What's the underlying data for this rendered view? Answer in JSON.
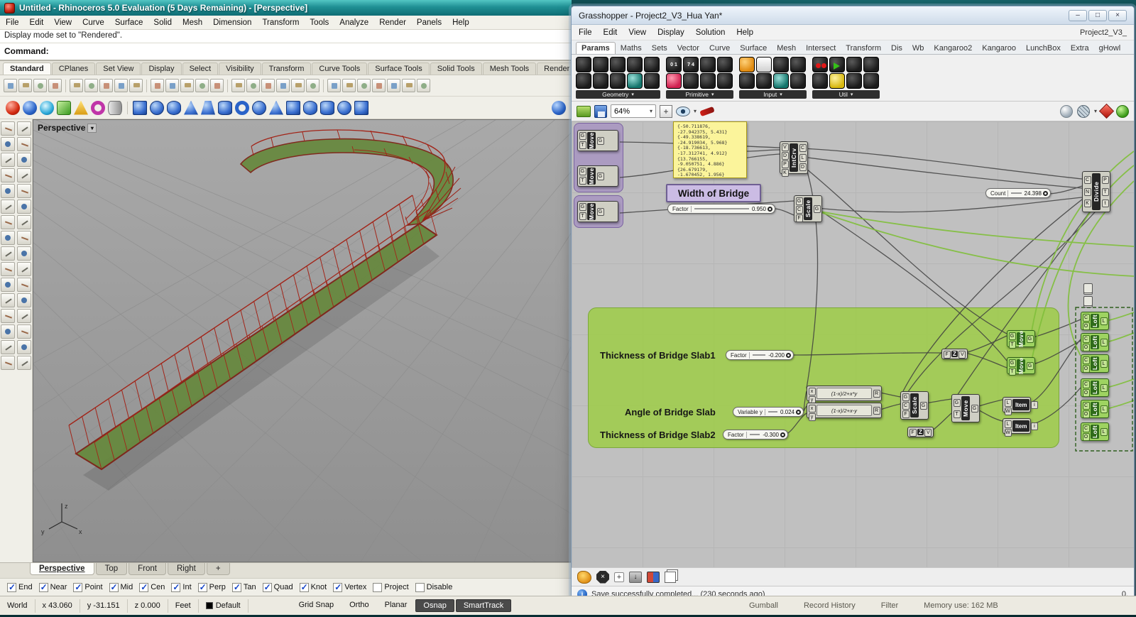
{
  "rhino": {
    "title": "Untitled - Rhinoceros 5.0 Evaluation (5 Days Remaining) - [Perspective]",
    "menu": [
      "File",
      "Edit",
      "View",
      "Curve",
      "Surface",
      "Solid",
      "Mesh",
      "Dimension",
      "Transform",
      "Tools",
      "Analyze",
      "Render",
      "Panels",
      "Help"
    ],
    "history_line": "Display mode set to \"Rendered\".",
    "command_label": "Command:",
    "toolbar_tabs": [
      "Standard",
      "CPlanes",
      "Set View",
      "Display",
      "Select",
      "Visibility",
      "Transform",
      "Curve Tools",
      "Surface Tools",
      "Solid Tools",
      "Mesh Tools",
      "Render T"
    ],
    "toolbar1_icons": [
      "new-file-icon",
      "open-file-icon",
      "save-icon",
      "print-icon",
      "cut-icon",
      "copy-icon",
      "paste-icon",
      "undo-icon",
      "redo-icon",
      "pan-icon",
      "zoom-extents-icon",
      "zoom-window-icon",
      "zoom-selected-icon",
      "rotate-view-icon",
      "grid-icon",
      "move-icon",
      "rotate-icon",
      "scale-icon",
      "hide-icon",
      "lock-icon",
      "layers-icon",
      "properties-icon",
      "render-icon",
      "shade-icon",
      "curve-tools-icon",
      "analyze-icon",
      "help-icon"
    ],
    "viewport": {
      "label": "Perspective",
      "tabs": [
        "Perspective",
        "Top",
        "Front",
        "Right"
      ],
      "new_tab": "+",
      "axis": {
        "x": "x",
        "y": "y",
        "z": "z"
      }
    },
    "osnap": {
      "items": [
        {
          "label": "End",
          "checked": true
        },
        {
          "label": "Near",
          "checked": true
        },
        {
          "label": "Point",
          "checked": true
        },
        {
          "label": "Mid",
          "checked": true
        },
        {
          "label": "Cen",
          "checked": true
        },
        {
          "label": "Int",
          "checked": true
        },
        {
          "label": "Perp",
          "checked": true
        },
        {
          "label": "Tan",
          "checked": true
        },
        {
          "label": "Quad",
          "checked": true
        },
        {
          "label": "Knot",
          "checked": true
        },
        {
          "label": "Vertex",
          "checked": true
        },
        {
          "label": "Project",
          "checked": false
        },
        {
          "label": "Disable",
          "checked": false
        }
      ]
    },
    "statusbar": {
      "cplane": "World",
      "x": "x 43.060",
      "y": "y -31.151",
      "z": "z 0.000",
      "units": "Feet",
      "layer": "Default",
      "panes": [
        "Grid Snap",
        "Ortho",
        "Planar",
        "Osnap",
        "SmartTrack"
      ],
      "right_panes": [
        "Gumball",
        "Record History",
        "Filter",
        "Memory use: 162 MB"
      ]
    }
  },
  "gh": {
    "title": "Grasshopper - Project2_V3_Hua Yan*",
    "window_buttons": {
      "minimize": "–",
      "maximize": "□",
      "close": "×"
    },
    "menu": [
      "File",
      "Edit",
      "View",
      "Display",
      "Solution",
      "Help"
    ],
    "doc_name": "Project2_V3_",
    "tabs": [
      "Params",
      "Maths",
      "Sets",
      "Vector",
      "Curve",
      "Surface",
      "Mesh",
      "Intersect",
      "Transform",
      "Dis",
      "Wb",
      "Kangaroo2",
      "Kangaroo",
      "LunchBox",
      "Extra",
      "gHowl"
    ],
    "palette": {
      "groups": [
        {
          "name": "Geometry",
          "icons": [
            "point-icon",
            "vector-icon",
            "plane-icon",
            "circle-icon",
            "curve-icon",
            "surface-icon",
            "brep-icon",
            "mesh-icon",
            "box-icon",
            "group-icon"
          ]
        },
        {
          "name": "Primitive",
          "icons": [
            "boolean-icon",
            "integer-icon",
            "number-icon",
            "text-icon",
            "colour-icon",
            "domain-icon",
            "path-icon",
            "matrix-icon"
          ]
        },
        {
          "name": "Input",
          "icons": [
            "number-slider-icon",
            "panel-icon",
            "value-list-icon",
            "button-icon",
            "toggle-icon",
            "graph-mapper-icon",
            "gradient-icon",
            "import-icon"
          ]
        },
        {
          "name": "Util",
          "icons": [
            "cherry-picker-icon",
            "jump-icon",
            "data-dam-icon",
            "relay-icon",
            "cluster-icon",
            "scribble-icon",
            "data-recorder-icon",
            "trigger-icon"
          ]
        }
      ],
      "boolean_glyph": "0 1",
      "integer_glyph": "7 4"
    },
    "toolbar": {
      "zoom": "64%"
    },
    "canvas": {
      "panels": {
        "width_of_bridge": "Width of Bridge",
        "thickness1": "Thickness of Bridge Slab1",
        "angle": "Angle of Bridge Slab",
        "thickness2": "Thickness of Bridge Slab2"
      },
      "yellow_panel_lines": [
        "{-50.711876,",
        "-27.942375, 5.431}",
        "{-49.338619,",
        "-24.919034, 5.968}",
        "{-18.736613,",
        "-17.312741, 4.912}",
        "{13.766155,",
        "-9.050751, 4.886}",
        "{26.679179,",
        "-1.670452, 1.956}"
      ],
      "sliders": {
        "width_factor": {
          "name": "Factor",
          "value": "0.950"
        },
        "count": {
          "name": "Count",
          "value": "24.398"
        },
        "thickness1_factor": {
          "name": "Factor",
          "value": "-0.200"
        },
        "angle_variable": {
          "name": "Variable y",
          "value": "0.024"
        },
        "thickness2_factor": {
          "name": "Factor",
          "value": "-0.300"
        }
      },
      "components": {
        "move": {
          "label": "Move",
          "in": [
            "G",
            "T"
          ],
          "out": [
            "G"
          ]
        },
        "intcrv": {
          "label": "IntCrv",
          "in": [
            "V",
            "D",
            "P",
            "K"
          ],
          "out": [
            "C",
            "L",
            "D"
          ]
        },
        "scale": {
          "label": "Scale",
          "in": [
            "G",
            "C",
            "F"
          ],
          "out": [
            "G"
          ]
        },
        "divide": {
          "label": "Divide",
          "in": [
            "C",
            "N",
            "K"
          ],
          "out": [
            "P",
            "T",
            "t"
          ]
        },
        "expr1": {
          "label": "(1-x)/2+x*y",
          "in": [
            "x",
            "y"
          ],
          "out": [
            "R"
          ]
        },
        "expr2": {
          "label": "(1-x)/2+x-y",
          "in": [
            "x",
            "y"
          ],
          "out": [
            "R"
          ]
        },
        "item": {
          "label": "Item",
          "in": [
            "L",
            "W"
          ],
          "out": [
            "i"
          ]
        },
        "loft": {
          "label": "Loft",
          "in": [
            "C",
            "O"
          ],
          "out": [
            "L"
          ]
        },
        "unitz": {
          "label": "Z",
          "in": [
            "F"
          ],
          "out": [
            "V"
          ]
        }
      }
    },
    "bottom_status": {
      "message": "Save successfully completed... (230 seconds ago)",
      "right": "0."
    }
  }
}
